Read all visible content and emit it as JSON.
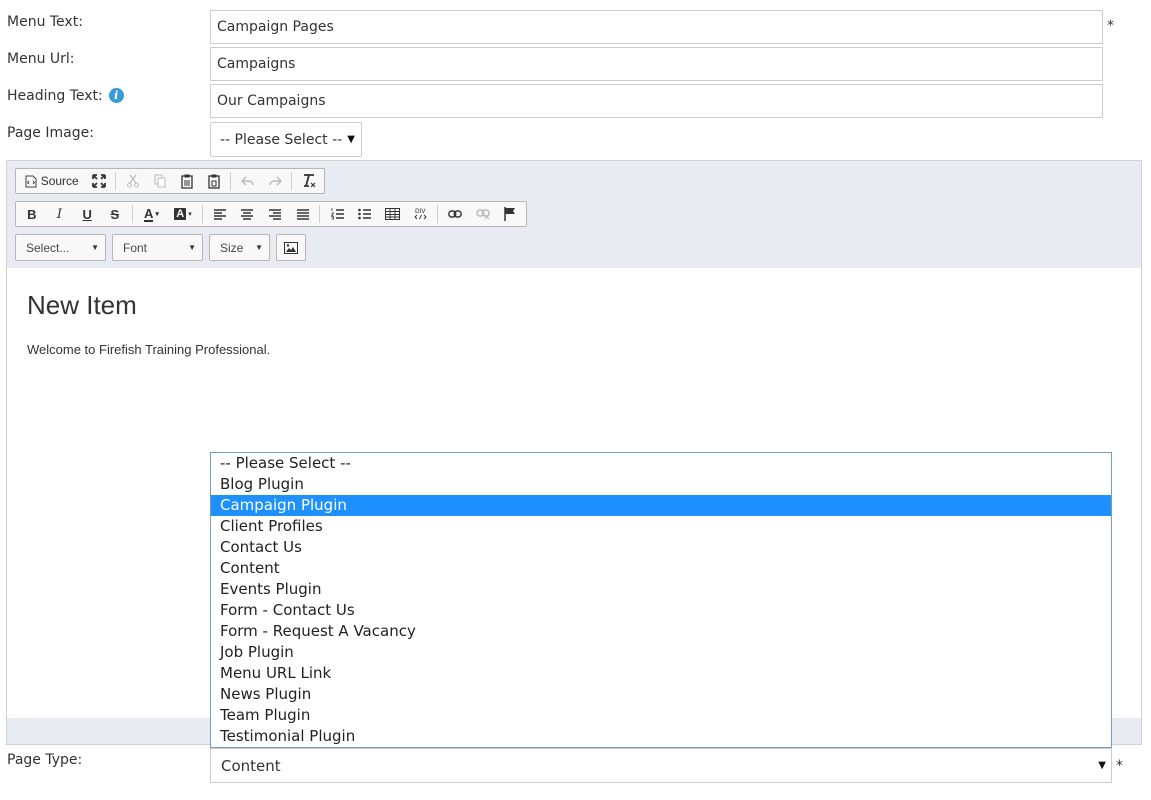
{
  "form": {
    "menu_text_label": "Menu Text:",
    "menu_text_value": "Campaign Pages",
    "menu_url_label": "Menu Url:",
    "menu_url_value": "Campaigns",
    "heading_text_label": "Heading Text:",
    "heading_text_value": "Our Campaigns",
    "page_image_label": "Page Image:",
    "page_image_value": "-- Please Select --",
    "page_type_label": "Page Type:",
    "page_type_value": "Content",
    "required_mark": "*"
  },
  "editor": {
    "toolbar": {
      "source_label": "Source",
      "format_combo": "Select...",
      "font_combo": "Font",
      "size_combo": "Size"
    },
    "content": {
      "heading": "New Item",
      "paragraph": "Welcome to Firefish Training Professional."
    }
  },
  "page_type_dropdown": {
    "options": [
      "-- Please Select --",
      "Blog Plugin",
      "Campaign Plugin",
      "Client Profiles",
      "Contact Us",
      "Content",
      "Events Plugin",
      "Form - Contact Us",
      "Form - Request A Vacancy",
      "Job Plugin",
      "Menu URL Link",
      "News Plugin",
      "Team Plugin",
      "Testimonial Plugin"
    ],
    "highlighted": "Campaign Plugin"
  },
  "colors": {
    "highlight": "#1e90ff",
    "info_icon": "#3a9ad9",
    "editor_chrome": "#e9ebf2"
  }
}
